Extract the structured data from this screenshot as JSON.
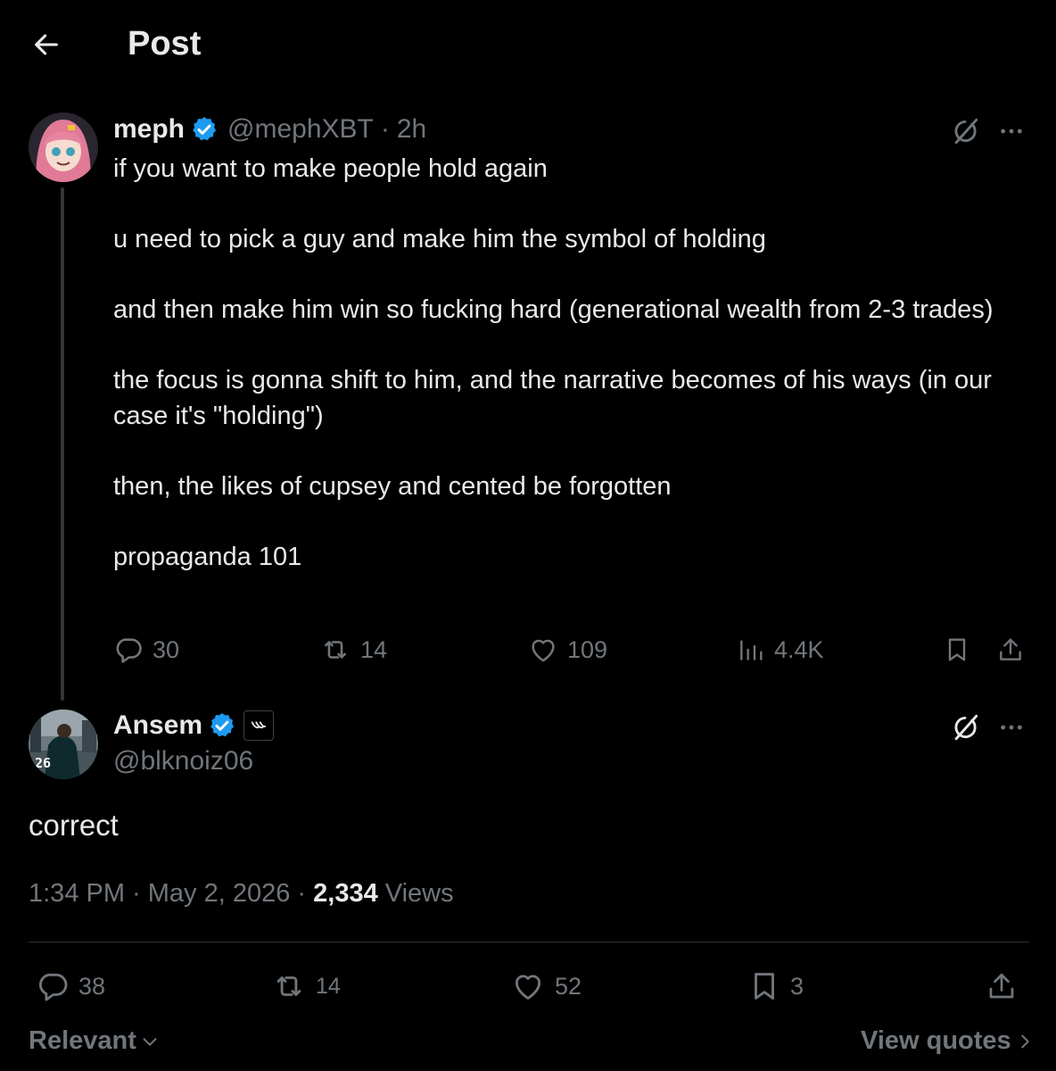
{
  "header": {
    "title": "Post"
  },
  "quoted_post": {
    "author": {
      "name": "meph",
      "handle": "@mephXBT",
      "time": "2h"
    },
    "paragraphs": [
      "if you want to make people hold again",
      "u need to pick a guy and make him the symbol of holding",
      "and then make him win so fucking hard (generational wealth from 2-3 trades)",
      "the focus is gonna shift to him, and the narrative becomes of his ways (in our case it's \"holding\")",
      "then, the likes of cupsey and cented be forgotten",
      "propaganda 101"
    ],
    "stats": {
      "replies": "30",
      "reposts": "14",
      "likes": "109",
      "views": "4.4K"
    }
  },
  "main_post": {
    "author": {
      "name": "Ansem",
      "handle": "@blknoiz06",
      "avatar_jersey": "26"
    },
    "text": "correct",
    "timestamp": "1:34 PM · May 2, 2026 · ",
    "views_count": "2,334",
    "views_label": " Views",
    "stats": {
      "replies": "38",
      "reposts": "14",
      "likes": "52",
      "bookmarks": "3"
    }
  },
  "footer": {
    "sort_label": "Relevant",
    "view_quotes_label": "View quotes"
  },
  "colors": {
    "background": "#000000",
    "text": "#e7e9ea",
    "muted": "#71767b",
    "verified": "#1d9bf0",
    "divider": "#2f3336"
  },
  "icons": [
    "back-arrow-icon",
    "verified-icon",
    "grok-icon",
    "more-icon",
    "reply-icon",
    "repost-icon",
    "like-icon",
    "views-icon",
    "bookmark-icon",
    "share-icon",
    "chevron-down-icon",
    "chevron-right-icon"
  ]
}
